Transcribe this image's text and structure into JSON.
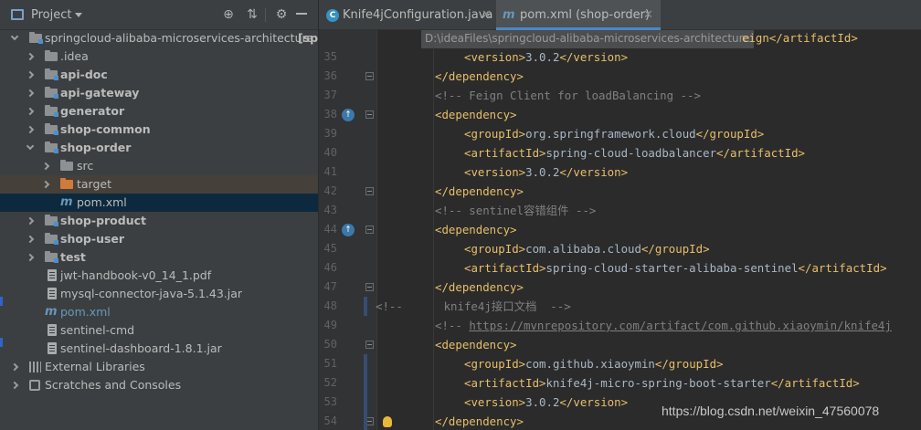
{
  "project_panel": {
    "title": "Project",
    "tree": [
      {
        "label": "springcloud-alibaba-microservices-architecture",
        "suffix": "[springcloud-alibaba]",
        "indent": 0,
        "expanded": true,
        "icon": "module-folder-icon"
      },
      {
        "label": ".idea",
        "indent": 1,
        "expanded": false,
        "icon": "folder-icon"
      },
      {
        "label": "api-doc",
        "indent": 1,
        "expanded": false,
        "icon": "module-folder-icon",
        "bold": true
      },
      {
        "label": "api-gateway",
        "indent": 1,
        "expanded": false,
        "icon": "module-folder-icon",
        "bold": true
      },
      {
        "label": "generator",
        "indent": 1,
        "expanded": false,
        "icon": "module-folder-icon",
        "bold": true
      },
      {
        "label": "shop-common",
        "indent": 1,
        "expanded": false,
        "icon": "module-folder-icon",
        "bold": true
      },
      {
        "label": "shop-order",
        "indent": 1,
        "expanded": true,
        "icon": "module-folder-icon",
        "bold": true
      },
      {
        "label": "src",
        "indent": 2,
        "expanded": false,
        "icon": "folder-icon"
      },
      {
        "label": "target",
        "indent": 2,
        "expanded": false,
        "icon": "excluded-folder-icon"
      },
      {
        "label": "pom.xml",
        "indent": 2,
        "icon": "maven-icon"
      },
      {
        "label": "shop-product",
        "indent": 1,
        "expanded": false,
        "icon": "module-folder-icon",
        "bold": true
      },
      {
        "label": "shop-user",
        "indent": 1,
        "expanded": false,
        "icon": "module-folder-icon",
        "bold": true
      },
      {
        "label": "test",
        "indent": 1,
        "expanded": false,
        "icon": "module-folder-icon",
        "bold": true
      },
      {
        "label": "jwt-handbook-v0_14_1.pdf",
        "indent": 1,
        "icon": "file-icon"
      },
      {
        "label": "mysql-connector-java-5.1.43.jar",
        "indent": 1,
        "icon": "jar-icon"
      },
      {
        "label": "pom.xml",
        "indent": 1,
        "icon": "maven-icon",
        "blue": true
      },
      {
        "label": "sentinel-cmd",
        "indent": 1,
        "icon": "file-icon"
      },
      {
        "label": "sentinel-dashboard-1.8.1.jar",
        "indent": 1,
        "icon": "jar-icon"
      },
      {
        "label": "External Libraries",
        "indent": 0,
        "expanded": false,
        "icon": "libraries-icon"
      },
      {
        "label": "Scratches and Consoles",
        "indent": 0,
        "expanded": false,
        "icon": "scratches-icon"
      }
    ],
    "path_tooltip": "D:\\ideaFiles\\springcloud-alibaba-microservices-architecture"
  },
  "tabs": [
    {
      "label": "Knife4jConfiguration.java",
      "active": false,
      "icon": "java-class-icon"
    },
    {
      "label": "pom.xml (shop-order)",
      "active": true,
      "icon": "maven-icon"
    }
  ],
  "editor": {
    "line_numbers": [
      "35",
      "36",
      "37",
      "38",
      "39",
      "40",
      "41",
      "42",
      "43",
      "44",
      "45",
      "46",
      "47",
      "48",
      "49",
      "50",
      "51",
      "52",
      "53",
      "54"
    ],
    "lines": {
      "l34_tail": "eign</artifactId>",
      "l35_val": "3.0.2",
      "l37_comment": "<!-- Feign Client for loadBalancing -->",
      "l39_val": "org.springframework.cloud",
      "l40_val": "spring-cloud-loadbalancer",
      "l41_val": "3.0.2",
      "l43_comment": "<!-- sentinel容错组件 -->",
      "l45_val": "com.alibaba.cloud",
      "l46_val": "spring-cloud-starter-alibaba-sentinel",
      "l48_comment": "<!--      knife4j接口文档  -->",
      "l49_comment_prefix": "<!-- ",
      "l49_link": "https://mvnrepository.com/artifact/com.github.xiaoymin/knife4j",
      "l51_val": "com.github.xiaoymin",
      "l52_val": "knife4j-micro-spring-boot-starter",
      "l53_val": "3.0.2"
    }
  },
  "watermark": "https://blog.csdn.net/weixin_47560078"
}
